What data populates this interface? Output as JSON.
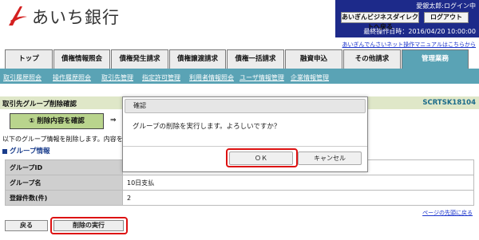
{
  "header": {
    "brand": "あいち銀行",
    "user": "愛銀太郎:ログイン中",
    "direct_button": "あいぎんビジネスダイレクトへ戻る",
    "logout_button": "ログアウト",
    "last_operation": "最終操作日時：2016/04/20 10:00:00",
    "manual_link": "あいぎんでんさいネット操作マニュアルはこちらから",
    "accent": "#1d2a8a"
  },
  "tabs": [
    {
      "label": "トップ"
    },
    {
      "label": "債権情報照会"
    },
    {
      "label": "債権発生請求"
    },
    {
      "label": "債権譲渡請求"
    },
    {
      "label": "債権一括請求"
    },
    {
      "label": "融資申込"
    },
    {
      "label": "その他請求"
    },
    {
      "label": "管理業務"
    }
  ],
  "subnav": [
    "取引履歴照会",
    "操作履歴照会",
    "取引先管理",
    "指定許可管理",
    "利用者情報照会",
    "ユーザ情報管理",
    "企業情報管理"
  ],
  "page": {
    "title": "取引先グループ削除確認",
    "screen_id": "SCRTSK18104",
    "step": "① 削除内容を確認",
    "step_arrow": "⇒",
    "description": "以下のグループ情報を削除します。内容を確認",
    "section": "グループ情報"
  },
  "table": [
    {
      "label": "グループID",
      "value": ""
    },
    {
      "label": "グループ名",
      "value": "10日支払"
    },
    {
      "label": "登録件数(件)",
      "value": "2"
    }
  ],
  "pagetop": "ページの先頭に戻る",
  "buttons": {
    "back": "戻る",
    "execute": "削除の実行"
  },
  "dialog": {
    "title": "確認",
    "message": "グループの削除を実行します。よろしいですか？",
    "ok": "ＯＫ",
    "cancel": "キャンセル"
  }
}
